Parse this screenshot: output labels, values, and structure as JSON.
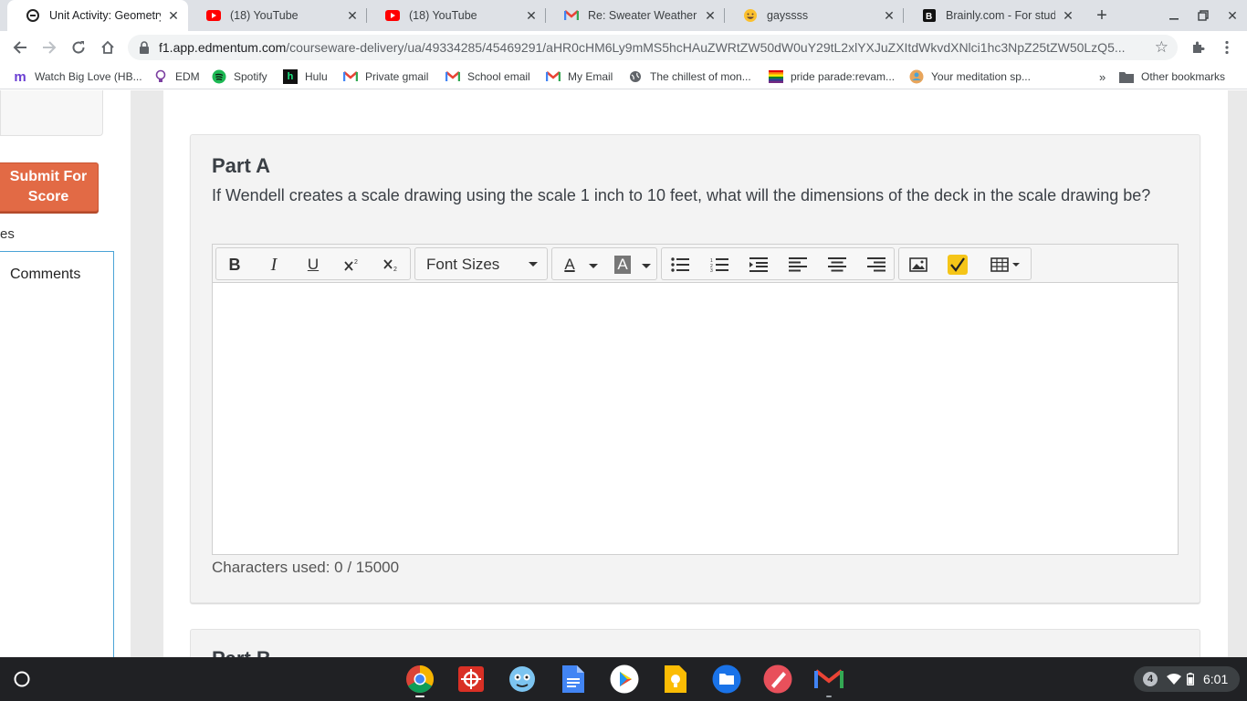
{
  "tabs": [
    {
      "title": "Unit Activity: Geometry",
      "favicon": "edmentum-icon",
      "active": true
    },
    {
      "title": "(18) YouTube",
      "favicon": "youtube-icon",
      "active": false
    },
    {
      "title": "(18) YouTube",
      "favicon": "youtube-icon",
      "active": false
    },
    {
      "title": "Re: Sweater Weather - br",
      "favicon": "gmail-icon",
      "active": false
    },
    {
      "title": "gayssss",
      "favicon": "emoji-icon",
      "active": false
    },
    {
      "title": "Brainly.com - For studen",
      "favicon": "brainly-icon",
      "active": false
    }
  ],
  "address": {
    "host": "f1.app.edmentum.com",
    "path": "/courseware-delivery/ua/49334285/45469291/aHR0cHM6Ly9mMS5hcHAuZWRtZW50dW0uY29tL2xlYXJuZXItdWkvdXNlci1hc3NpZ25tZW50LzQ5..."
  },
  "bookmarks": [
    {
      "label": "Watch Big Love (HB...",
      "icon": "m-icon"
    },
    {
      "label": "EDM",
      "icon": "lightbulb-icon"
    },
    {
      "label": "Spotify",
      "icon": "spotify-icon"
    },
    {
      "label": "Hulu",
      "icon": "hulu-icon"
    },
    {
      "label": "Private gmail",
      "icon": "gmail-icon"
    },
    {
      "label": "School email",
      "icon": "gmail-icon"
    },
    {
      "label": "My Email",
      "icon": "gmail-icon"
    },
    {
      "label": "The chillest of mon...",
      "icon": "globe-icon"
    },
    {
      "label": "pride parade:revam...",
      "icon": "flag-icon"
    },
    {
      "label": "Your meditation sp...",
      "icon": "meditation-icon"
    }
  ],
  "bookmarks_more": "»",
  "other_bookmarks": "Other bookmarks",
  "left": {
    "submit_label": "Submit For Score",
    "partial_text": "es",
    "comments_label": "Comments"
  },
  "question": {
    "part_title": "Part A",
    "text": "If Wendell creates a scale drawing using the scale 1 inch to 10 feet, what will the dimensions of the deck in the scale drawing be?",
    "next_part_title": "Part B"
  },
  "editor": {
    "bold": "B",
    "italic": "I",
    "underline": "U",
    "font_sizes_label": "Font Sizes",
    "font_color_letter": "A",
    "bg_color_letter": "A",
    "chars_used": "Characters used: 0 / 15000"
  },
  "tray": {
    "notifications": "4",
    "time": "6:01"
  }
}
